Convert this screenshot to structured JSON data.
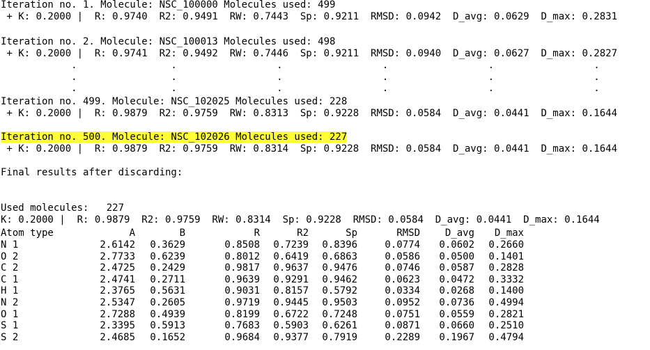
{
  "iterations": [
    {
      "header": "Iteration no. 1. Molecule: NSC_100000 Molecules used: 499",
      "stats": " + K: 0.2000 |  R: 0.9740  R2: 0.9491  RW: 0.7443  Sp: 0.9211  RMSD: 0.0942  D_avg: 0.0629  D_max: 0.2831"
    },
    {
      "header": "Iteration no. 2. Molecule: NSC_100013 Molecules used: 498",
      "stats": " + K: 0.2000 |  R: 0.9741  R2: 0.9492  RW: 0.7446  Sp: 0.9211  RMSD: 0.0940  D_avg: 0.0627  D_max: 0.2827"
    },
    {
      "header": "Iteration no. 499. Molecule: NSC_102025 Molecules used: 228",
      "stats": " + K: 0.2000 |  R: 0.9879  R2: 0.9759  RW: 0.8313  Sp: 0.9228  RMSD: 0.0584  D_avg: 0.0441  D_max: 0.1644"
    },
    {
      "header": "Iteration no. 500. Molecule: NSC_102026 Molecules used: 227",
      "stats": " + K: 0.2000 |  R: 0.9879  R2: 0.9759  RW: 0.8314  Sp: 0.9228  RMSD: 0.0584  D_avg: 0.0441  D_max: 0.1644"
    }
  ],
  "ellipsis_line": "            .                .                 .                 .                 .                 .",
  "final_title": "Final results after discarding:",
  "used_molecules": "Used molecules:   227",
  "final_stats": "K: 0.2000 |  R: 0.9879  R2: 0.9759  RW: 0.8314  Sp: 0.9228  RMSD: 0.0584  D_avg: 0.0441  D_max: 0.1644",
  "table": {
    "columns": [
      "Atom type",
      "A",
      "B",
      "R",
      "R2",
      "Sp",
      "RMSD",
      "D_avg",
      "D_max"
    ],
    "rows": [
      [
        "N 1",
        "2.6142",
        "0.3629",
        "0.8508",
        "0.7239",
        "0.8396",
        "0.0774",
        "0.0602",
        "0.2660"
      ],
      [
        "O 2",
        "2.7733",
        "0.6239",
        "0.8012",
        "0.6419",
        "0.6863",
        "0.0586",
        "0.0500",
        "0.1401"
      ],
      [
        "C 2",
        "2.4725",
        "0.2429",
        "0.9817",
        "0.9637",
        "0.9476",
        "0.0746",
        "0.0587",
        "0.2828"
      ],
      [
        "C 1",
        "2.4741",
        "0.2711",
        "0.9639",
        "0.9291",
        "0.9462",
        "0.0623",
        "0.0472",
        "0.3332"
      ],
      [
        "H 1",
        "2.3765",
        "0.5631",
        "0.9031",
        "0.8157",
        "0.5792",
        "0.0334",
        "0.0268",
        "0.1400"
      ],
      [
        "N 2",
        "2.5347",
        "0.2605",
        "0.9719",
        "0.9445",
        "0.9503",
        "0.0952",
        "0.0736",
        "0.4994"
      ],
      [
        "O 1",
        "2.7288",
        "0.4939",
        "0.8199",
        "0.6722",
        "0.7248",
        "0.0751",
        "0.0559",
        "0.2821"
      ],
      [
        "S 1",
        "2.3395",
        "0.5913",
        "0.7683",
        "0.5903",
        "0.6261",
        "0.0871",
        "0.0660",
        "0.2510"
      ],
      [
        "S 2",
        "2.4685",
        "0.1652",
        "0.9684",
        "0.9377",
        "0.7919",
        "0.2289",
        "0.1967",
        "0.4794"
      ]
    ]
  },
  "colors": {
    "highlight": "#ffff33",
    "text": "#000000",
    "background": "#ffffff"
  }
}
